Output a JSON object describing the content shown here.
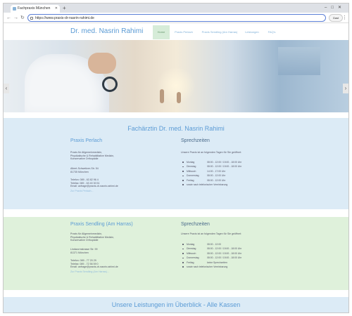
{
  "browser": {
    "tab_title": "Fachpraxis München",
    "url": "https://www.praxis-dr-nasrin-rahimi.de",
    "profile_label": "Gast"
  },
  "site": {
    "brand": "Dr. med. Nasrin Rahimi",
    "nav": [
      "Home",
      "Praxis Perlach",
      "Praxis Sendling (Am Harras)",
      "Leistungen",
      "FAQ's"
    ],
    "hero_prev": "‹",
    "hero_next": "›"
  },
  "main": {
    "heading": "Fachärztin Dr. med. Nasrin Rahimi",
    "footer_heading": "Unsere Leistungen im Überblick - Alle Kassen"
  },
  "practices": [
    {
      "name": "Praxis Perlach",
      "specialties": [
        "Praxis für Allgemeinmedizin,",
        "Physikalische & Rehabilitative Medizin,",
        "Konservative Orthopädie"
      ],
      "address": [
        "Albert-Schweitzer-Str. 54",
        "81735 München"
      ],
      "contact": [
        "Telefon: 089 - 63 82 96 4",
        "Telefax: 089 - 63 40 30 51",
        "Email: anfrage@praxis-dr-nasrin-rahimi.de"
      ],
      "link": "Zur Praxis Perlach...",
      "hours_title": "Sprechzeiten",
      "hours_intro": "Unsere Praxis ist an folgenden Tagen für Sie geöffnet:",
      "hours": [
        {
          "day": "Montag",
          "time": "08:00 - 12:00 / 15:00 - 18:00 Uhr"
        },
        {
          "day": "Dienstag",
          "time": "08:00 - 12:00 / 15:00 - 18:00 Uhr"
        },
        {
          "day": "Mittwoch",
          "time": "14:00 - 17:00 Uhr"
        },
        {
          "day": "Donnerstag",
          "time": "08:00 - 12:00 Uhr"
        },
        {
          "day": "Freitag",
          "time": "08:00 - 12:00 Uhr"
        },
        {
          "day": "sowie nach telefonischer Vereinbarung",
          "time": ""
        }
      ]
    },
    {
      "name": "Praxis Sendling (Am Harras)",
      "specialties": [
        "Praxis für Allgemeinmedizin,",
        "Physikalische & Rehabilitative Medizin,",
        "Konservative Orthopädie"
      ],
      "address": [
        "Lindwurmstrasse Str. 99",
        "81371 München"
      ],
      "contact": [
        "Telefon: 089 - 77 20 29",
        "Telefax: 089 - 72 56 59 0",
        "Email: anfrage@praxis-dr-nasrin-rahimi.de"
      ],
      "link": "Zur Praxis Sendling (Am Harras)...",
      "hours_title": "Sprechzeiten",
      "hours_intro": "Unsere Praxis ist an folgenden Tagen für Sie geöffnet:",
      "hours": [
        {
          "day": "Montag",
          "time": "08:00 - 12:00"
        },
        {
          "day": "Dienstag",
          "time": "08:00 - 12:00 / 15:00 - 18:00 Uhr"
        },
        {
          "day": "Mittwoch",
          "time": "08:00 - 12:00 / 15:00 - 18:00 Uhr"
        },
        {
          "day": "Donnerstag",
          "time": "08:00 - 12:00 / 15:00 - 18:00 Uhr"
        },
        {
          "day": "Freitag",
          "time": "keine Sprechzeiten"
        },
        {
          "day": "sowie nach telefonischer Vereinbarung",
          "time": ""
        }
      ]
    }
  ]
}
